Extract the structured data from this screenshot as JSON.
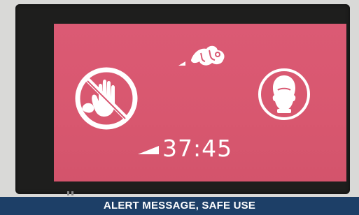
{
  "display": {
    "accent_color": "#d95872",
    "icons": {
      "no_touch": "no-touch-icon",
      "headgear": "headgear-icon",
      "spray": "spray-icon",
      "timer_level": "timer-level-icon"
    },
    "timer": "37:45"
  },
  "caption": {
    "text": "ALERT MESSAGE, SAFE USE",
    "background_color": "#1d3f67"
  }
}
